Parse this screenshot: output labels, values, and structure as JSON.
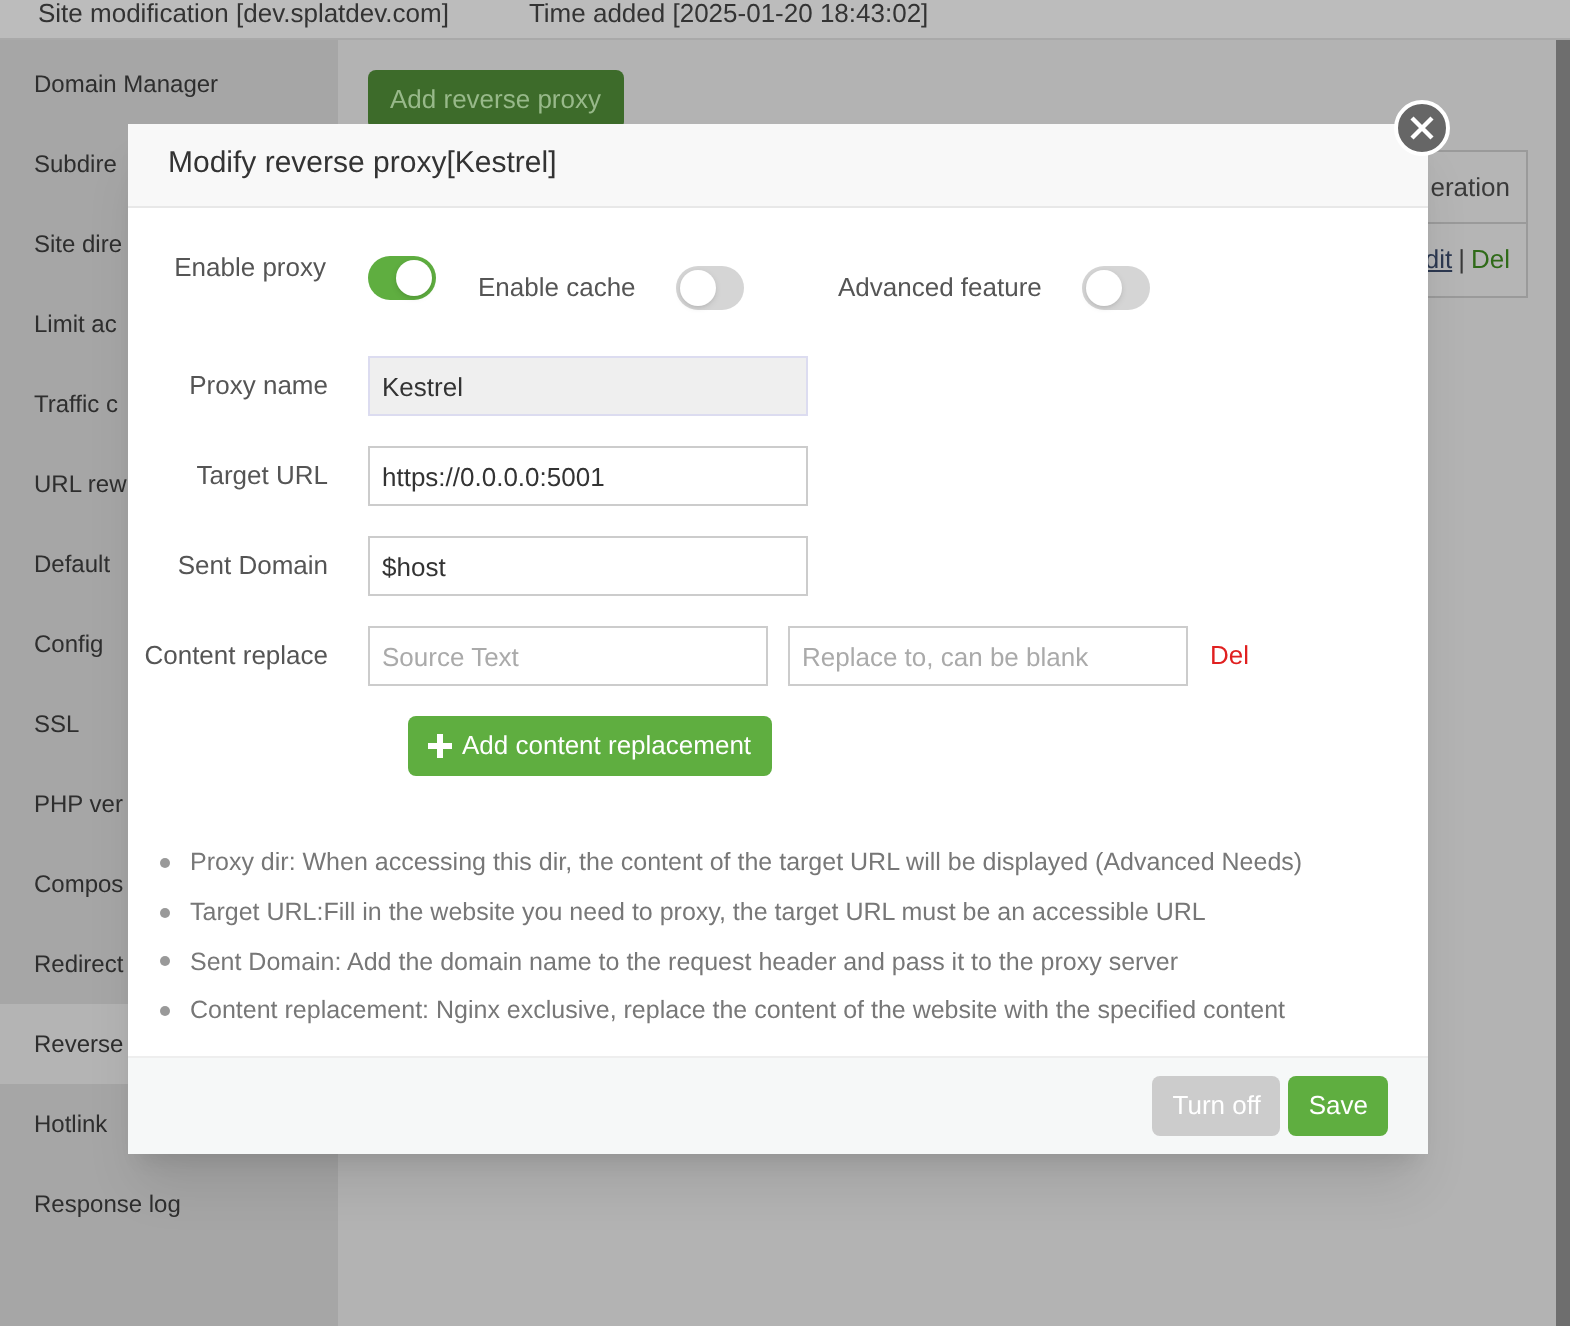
{
  "header": {
    "site": "Site modification [dev.splatdev.com]",
    "time": "Time added [2025-01-20 18:43:02]"
  },
  "sidebar": {
    "items": [
      {
        "label": "Domain Manager",
        "selected": false
      },
      {
        "label": "Subdire",
        "selected": false
      },
      {
        "label": "Site dire",
        "selected": false
      },
      {
        "label": "Limit ac",
        "selected": false
      },
      {
        "label": "Traffic c",
        "selected": false
      },
      {
        "label": "URL rew",
        "selected": false
      },
      {
        "label": "Default",
        "selected": false
      },
      {
        "label": "Config",
        "selected": false
      },
      {
        "label": "SSL",
        "selected": false
      },
      {
        "label": "PHP ver",
        "selected": false
      },
      {
        "label": "Compos",
        "selected": false
      },
      {
        "label": "Redirect",
        "selected": false
      },
      {
        "label": "Reverse",
        "selected": true
      },
      {
        "label": "Hotlink",
        "selected": false
      },
      {
        "label": "Response log",
        "selected": false
      }
    ]
  },
  "main": {
    "add_button": "Add reverse proxy",
    "table": {
      "column_header": "eration",
      "edit": "dit",
      "separator": "|",
      "del": "Del"
    }
  },
  "dialog": {
    "title": "Modify reverse proxy[Kestrel]",
    "toggles": [
      {
        "label": "Enable proxy",
        "on": true
      },
      {
        "label": "Enable cache",
        "on": false
      },
      {
        "label": "Advanced feature",
        "on": false
      }
    ],
    "fields": [
      {
        "label": "Proxy name",
        "value": "Kestrel",
        "disabled": true
      },
      {
        "label": "Target URL",
        "value": "https://0.0.0.0:5001",
        "disabled": false
      },
      {
        "label": "Sent Domain",
        "value": "$host",
        "disabled": false
      }
    ],
    "content_replace": {
      "label": "Content replace",
      "source_placeholder": "Source Text",
      "target_placeholder": "Replace to, can be blank",
      "del": "Del"
    },
    "add_replacement": "Add content replacement",
    "notes": [
      "Proxy dir: When accessing this dir, the content of the target URL will be displayed (Advanced Needs)",
      "Target URL:Fill in the website you need to proxy, the target URL must be an accessible URL",
      "Sent Domain: Add the domain name to the request header and pass it to the proxy server",
      "Content replacement: Nginx exclusive, replace the content of the website with the specified content"
    ],
    "buttons": [
      {
        "label": "Turn off",
        "disabled": true
      },
      {
        "label": "Save",
        "disabled": false
      }
    ]
  }
}
